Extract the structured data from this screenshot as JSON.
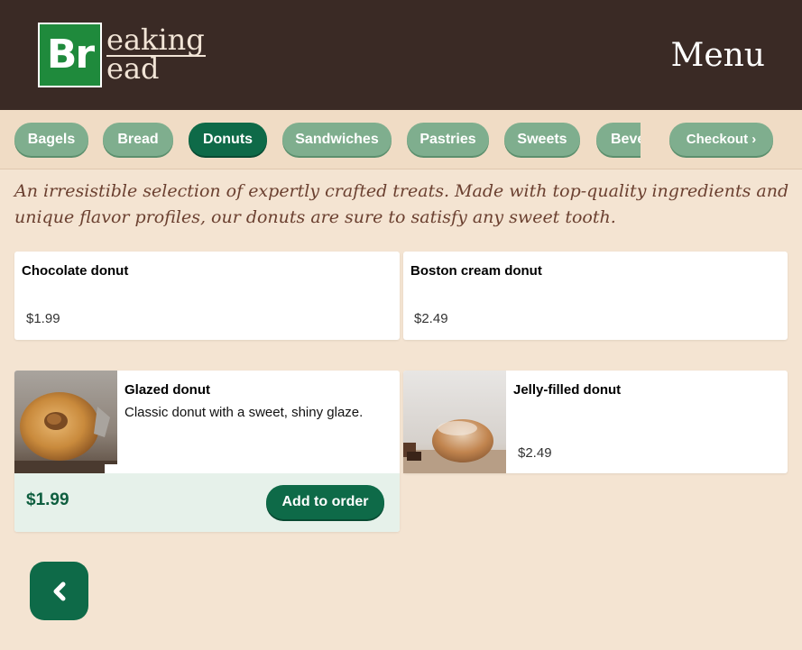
{
  "header": {
    "logo_box": "Br",
    "logo_line1": "eaking",
    "logo_line2": "ead",
    "title": "Menu"
  },
  "categories": [
    {
      "label": "Bagels",
      "active": false
    },
    {
      "label": "Bread",
      "active": false
    },
    {
      "label": "Donuts",
      "active": true
    },
    {
      "label": "Sandwiches",
      "active": false
    },
    {
      "label": "Pastries",
      "active": false
    },
    {
      "label": "Sweets",
      "active": false
    },
    {
      "label": "Beverages",
      "active": false
    }
  ],
  "checkout_label": "Checkout ›",
  "description": "An irresistible selection of expertly crafted treats. Made with top-quality ingredients and unique flavor profiles, our donuts are sure to satisfy any sweet tooth.",
  "items": [
    {
      "name": "Chocolate donut",
      "price": "$1.99"
    },
    {
      "name": "Boston cream donut",
      "price": "$2.49"
    },
    {
      "name": "Glazed donut",
      "description": "Classic donut with a sweet, shiny glaze.",
      "price": "$1.99",
      "add_label": "Add to order"
    },
    {
      "name": "Jelly-filled donut",
      "price": "$2.49"
    }
  ],
  "back_icon": "chevron-left-icon",
  "colors": {
    "header_bg": "#3a2a25",
    "page_bg": "#f4e4d2",
    "accent": "#0e6a48",
    "pill": "#7fae8e"
  }
}
